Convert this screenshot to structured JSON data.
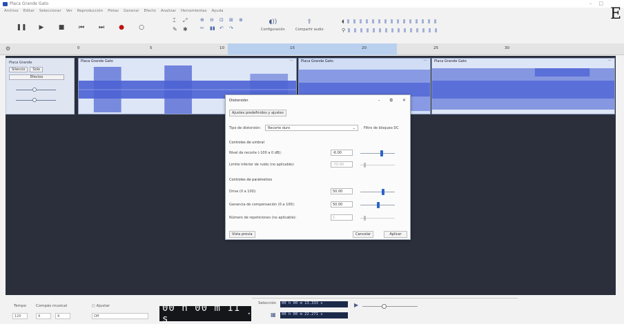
{
  "window": {
    "title": "Placa Grande Gato"
  },
  "corner_letter": "E",
  "menu": [
    "Archivo",
    "Editar",
    "Seleccionar",
    "Ver",
    "Reproducción",
    "Pistas",
    "Generar",
    "Efecto",
    "Analizar",
    "Herramientas",
    "Ayuda"
  ],
  "toolbar": {
    "transport": [
      {
        "icon": "pause-icon",
        "glyph": "❚❚"
      },
      {
        "icon": "play-icon",
        "glyph": "▶"
      },
      {
        "icon": "stop-icon",
        "glyph": "■"
      },
      {
        "icon": "skip-start-icon",
        "glyph": "⏮"
      },
      {
        "icon": "skip-end-icon",
        "glyph": "⏭"
      },
      {
        "icon": "record-icon",
        "glyph": "●"
      },
      {
        "icon": "loop-icon",
        "glyph": "○"
      }
    ],
    "audio_setup_label": "Configuración",
    "share_audio_label": "Compartir audio"
  },
  "timeline": {
    "ticks": [
      "0",
      "5",
      "10",
      "15",
      "20",
      "25",
      "30"
    ]
  },
  "track": {
    "name": "Placa Grande",
    "mute_label": "Silencio",
    "solo_label": "Solo",
    "effects_label": "Efectos",
    "clips": [
      {
        "name": "Placa Grande Gato"
      },
      {
        "name": "Placa Grande Gato"
      },
      {
        "name": "Placa Grande Gato"
      }
    ]
  },
  "dialog": {
    "title": "Distorsión",
    "presets_button": "Ajustes predefinidos y ajustes",
    "type_label": "Tipo de distorsión:",
    "type_value": "Recorte duro",
    "dc_block_label": "Filtro de bloqueo DC",
    "threshold_section": "Controles de umbral",
    "clip_level_label": "Nivel de recorte (-100 a 0 dB):",
    "clip_level_value": "-6.00",
    "clip_level_pos": 0.58,
    "noise_floor_label": "Limite inferior de ruido (no aplicable):",
    "noise_floor_value": "-70.00",
    "noise_floor_pos": 0.1,
    "param_section": "Controles de parámetros",
    "drive_label": "Drive (0 a 100):",
    "drive_value": "50.00",
    "drive_pos": 0.62,
    "makeup_label": "Ganancia de compensación (0 a 100):",
    "makeup_value": "50.00",
    "makeup_pos": 0.48,
    "repeats_label": "Número de repeticiones (no aplicable):",
    "repeats_value": "1",
    "repeats_pos": 0.1,
    "preview_button": "Vista previa",
    "cancel_button": "Cancelar",
    "apply_button": "Aplicar"
  },
  "bottom": {
    "tempo_label": "Tempo",
    "time_signature_label": "Compás musical",
    "snap_label": "Ajustar",
    "tempo_value": "120",
    "time_sig_num": "4",
    "time_sig_den": "4",
    "snap_value": "Off",
    "time_display": "00 h 00 m 11 s",
    "selection_label": "Selección",
    "selection_start": "00 h 00 m 13.333 s",
    "selection_end": "00 h 00 m 22.271 s"
  }
}
